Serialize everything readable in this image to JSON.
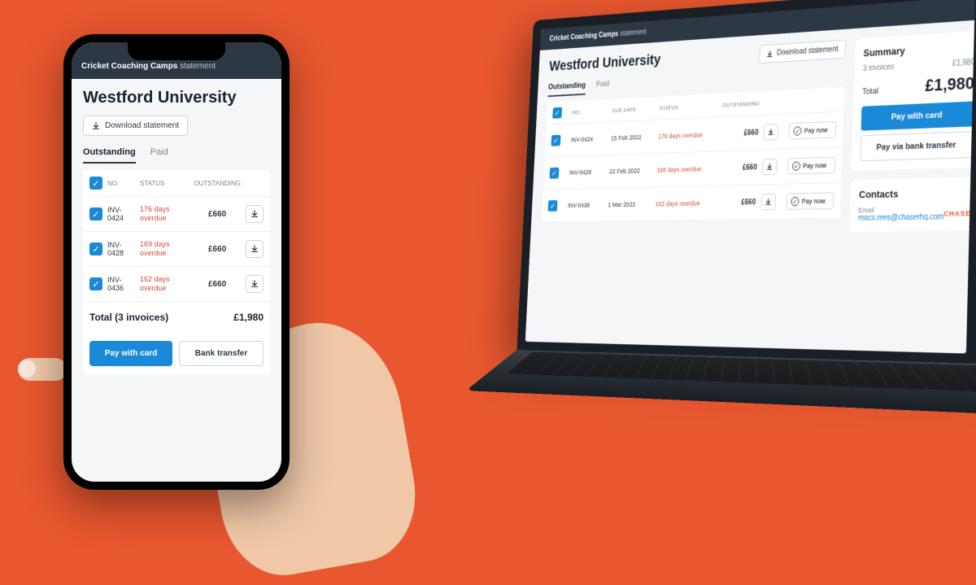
{
  "header": {
    "org": "Cricket Coaching Camps",
    "suffix": "statement"
  },
  "customer": "Westford University",
  "download_label": "Download statement",
  "tabs": {
    "outstanding": "Outstanding",
    "paid": "Paid"
  },
  "columns": {
    "no": "NO.",
    "due": "DUE DATE",
    "status": "STATUS",
    "outstanding": "OUTSTANDING"
  },
  "invoices": [
    {
      "no": "INV-0424",
      "no_short": "INV-\n0424",
      "due": "15 Feb 2022",
      "status": "176 days overdue",
      "status_short": "176 days overdue",
      "amount": "£660"
    },
    {
      "no": "INV-0428",
      "no_short": "INV-\n0428",
      "due": "22 Feb 2022",
      "status": "169 days overdue",
      "status_short": "169 days overdue",
      "amount": "£660"
    },
    {
      "no": "INV-0436",
      "no_short": "INV-\n0436",
      "due": "1 Mar 2022",
      "status": "162 days overdue",
      "status_short": "162 days overdue",
      "amount": "£660"
    }
  ],
  "pay_now": "Pay now",
  "total": {
    "label_mobile": "Total (3 invoices)",
    "label": "Total",
    "invoices_count": "3 invoices",
    "amount": "£1,980"
  },
  "actions": {
    "pay_card": "Pay with card",
    "bank_mobile": "Bank transfer",
    "bank_desktop": "Pay via bank transfer"
  },
  "summary_title": "Summary",
  "contacts": {
    "title": "Contacts",
    "email_label": "Email",
    "email": "macs.rees@chaserhq.com",
    "brand": "CHASER"
  }
}
